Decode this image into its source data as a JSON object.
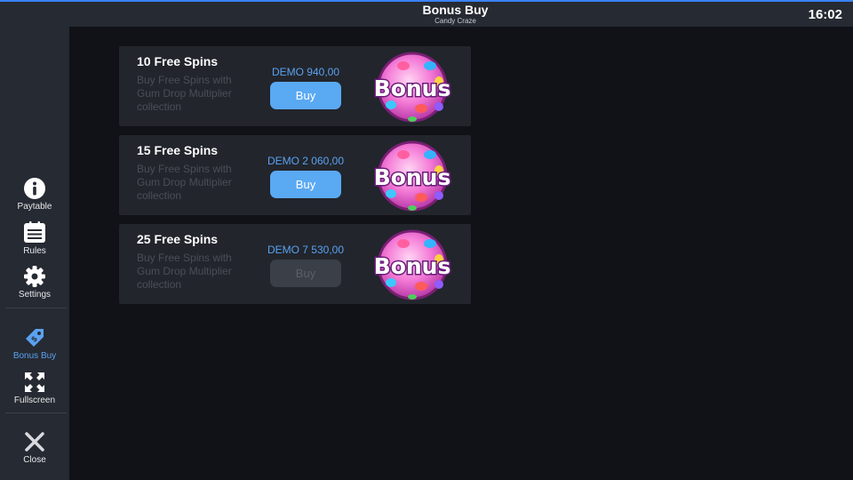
{
  "header": {
    "title": "Bonus Buy",
    "subtitle": "Candy Craze",
    "time": "16:02"
  },
  "sidebar": {
    "items": [
      {
        "label": "Paytable",
        "icon": "info-icon"
      },
      {
        "label": "Rules",
        "icon": "rules-icon"
      },
      {
        "label": "Settings",
        "icon": "gear-icon"
      },
      {
        "label": "Bonus Buy",
        "icon": "tag-icon",
        "active": true
      },
      {
        "label": "Fullscreen",
        "icon": "fullscreen-icon"
      },
      {
        "label": "Close",
        "icon": "close-icon"
      }
    ]
  },
  "offers": [
    {
      "title": "10 Free Spins",
      "description": "Buy Free Spins with Gum Drop Multiplier collection",
      "price": "DEMO 940,00",
      "button": "Buy",
      "enabled": true,
      "badge": "Bonus"
    },
    {
      "title": "15 Free Spins",
      "description": "Buy Free Spins with Gum Drop Multiplier collection",
      "price": "DEMO 2 060,00",
      "button": "Buy",
      "enabled": true,
      "badge": "Bonus"
    },
    {
      "title": "25 Free Spins",
      "description": "Buy Free Spins with Gum Drop Multiplier collection",
      "price": "DEMO 7 530,00",
      "button": "Buy",
      "enabled": false,
      "badge": "Bonus"
    }
  ],
  "colors": {
    "accent": "#3b82f6",
    "active_nav": "#5aa2f0",
    "buy_button": "#5aa9f3",
    "buy_button_disabled": "#3a3f48",
    "sidebar_bg": "#262a32",
    "card_bg": "#22252c",
    "page_bg": "#101217"
  }
}
